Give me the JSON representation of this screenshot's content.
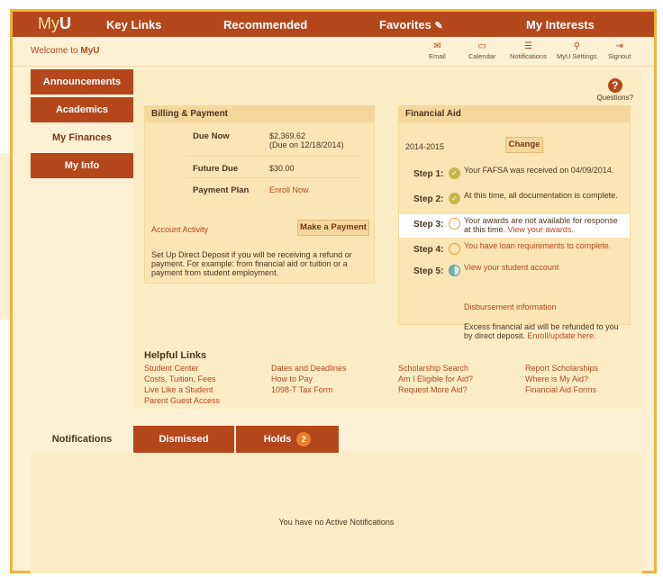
{
  "app": {
    "logo_prefix": "My",
    "logo_bold": "U"
  },
  "topnav": {
    "key_links": "Key Links",
    "recommended": "Recommended",
    "favorites": "Favorites",
    "my_interests": "My Interests"
  },
  "subheader": {
    "welcome_prefix": "Welcome to ",
    "welcome_brand": "MyU",
    "utilities": [
      {
        "label": "Email",
        "icon": "mail-icon"
      },
      {
        "label": "Calendar",
        "icon": "calendar-icon"
      },
      {
        "label": "Notifications",
        "icon": "list-icon"
      },
      {
        "label": "MyU Settings",
        "icon": "person-icon"
      },
      {
        "label": "Signout",
        "icon": "signout-icon"
      }
    ]
  },
  "sidebar": {
    "items": [
      {
        "label": "Announcements"
      },
      {
        "label": "Academics"
      },
      {
        "label": "My Finances",
        "active": true
      },
      {
        "label": "My Info"
      }
    ]
  },
  "questions": {
    "label": "Questions?"
  },
  "billing": {
    "title": "Billing & Payment",
    "rows": [
      {
        "label": "Due Now",
        "value": "$2,369.62",
        "value2": "(Due on 12/18/2014)"
      },
      {
        "label": "Future Due",
        "value": "$30.00"
      },
      {
        "label": "Payment Plan",
        "value": "Enroll Now"
      }
    ],
    "account_activity": "Account Activity",
    "make_payment": "Make a Payment",
    "deposit_text": "Set Up Direct Deposit if you will be receiving a refund or payment. For example: from financial aid or tuition or a payment from student employment."
  },
  "financial_aid": {
    "title": "Financial Aid",
    "year": "2014-2015",
    "change_label": "Change",
    "steps": [
      {
        "label": "Step 1:",
        "text": "Your FAFSA was received on 04/09/2014.",
        "link": ""
      },
      {
        "label": "Step 2:",
        "text": "At this time, all documentation is complete.",
        "link": ""
      },
      {
        "label": "Step 3:",
        "text": "Your awards are not available for response at this time. ",
        "link": "View your awards."
      },
      {
        "label": "Step 4:",
        "text": "",
        "link": "You have loan requirements to complete."
      },
      {
        "label": "Step 5:",
        "text": "",
        "link": "View your student account"
      }
    ],
    "disbursement": "Disbursement information",
    "excess_text": "Excess financial aid will be refunded to you by direct deposit. ",
    "excess_link": "Enroll/update here."
  },
  "helpful_links": {
    "title": "Helpful Links",
    "col1": [
      "Student Center",
      "Costs, Tuition, Fees",
      "Live Like a Student",
      "Parent Guest Access"
    ],
    "col2": [
      "Dates and Deadlines",
      "How to Pay",
      "1098-T Tax Form"
    ],
    "col3": [
      "Scholarship Search",
      "Am I Eligible for Aid?",
      "Request More Aid?"
    ],
    "col4": [
      "Report Scholarships",
      "Where is My Aid?",
      "Financial Aid Forms"
    ]
  },
  "notifications": {
    "tabs": [
      {
        "label": "Notifications"
      },
      {
        "label": "Dismissed"
      },
      {
        "label": "Holds",
        "badge": "2"
      }
    ],
    "empty_text": "You have no Active Notifications"
  }
}
